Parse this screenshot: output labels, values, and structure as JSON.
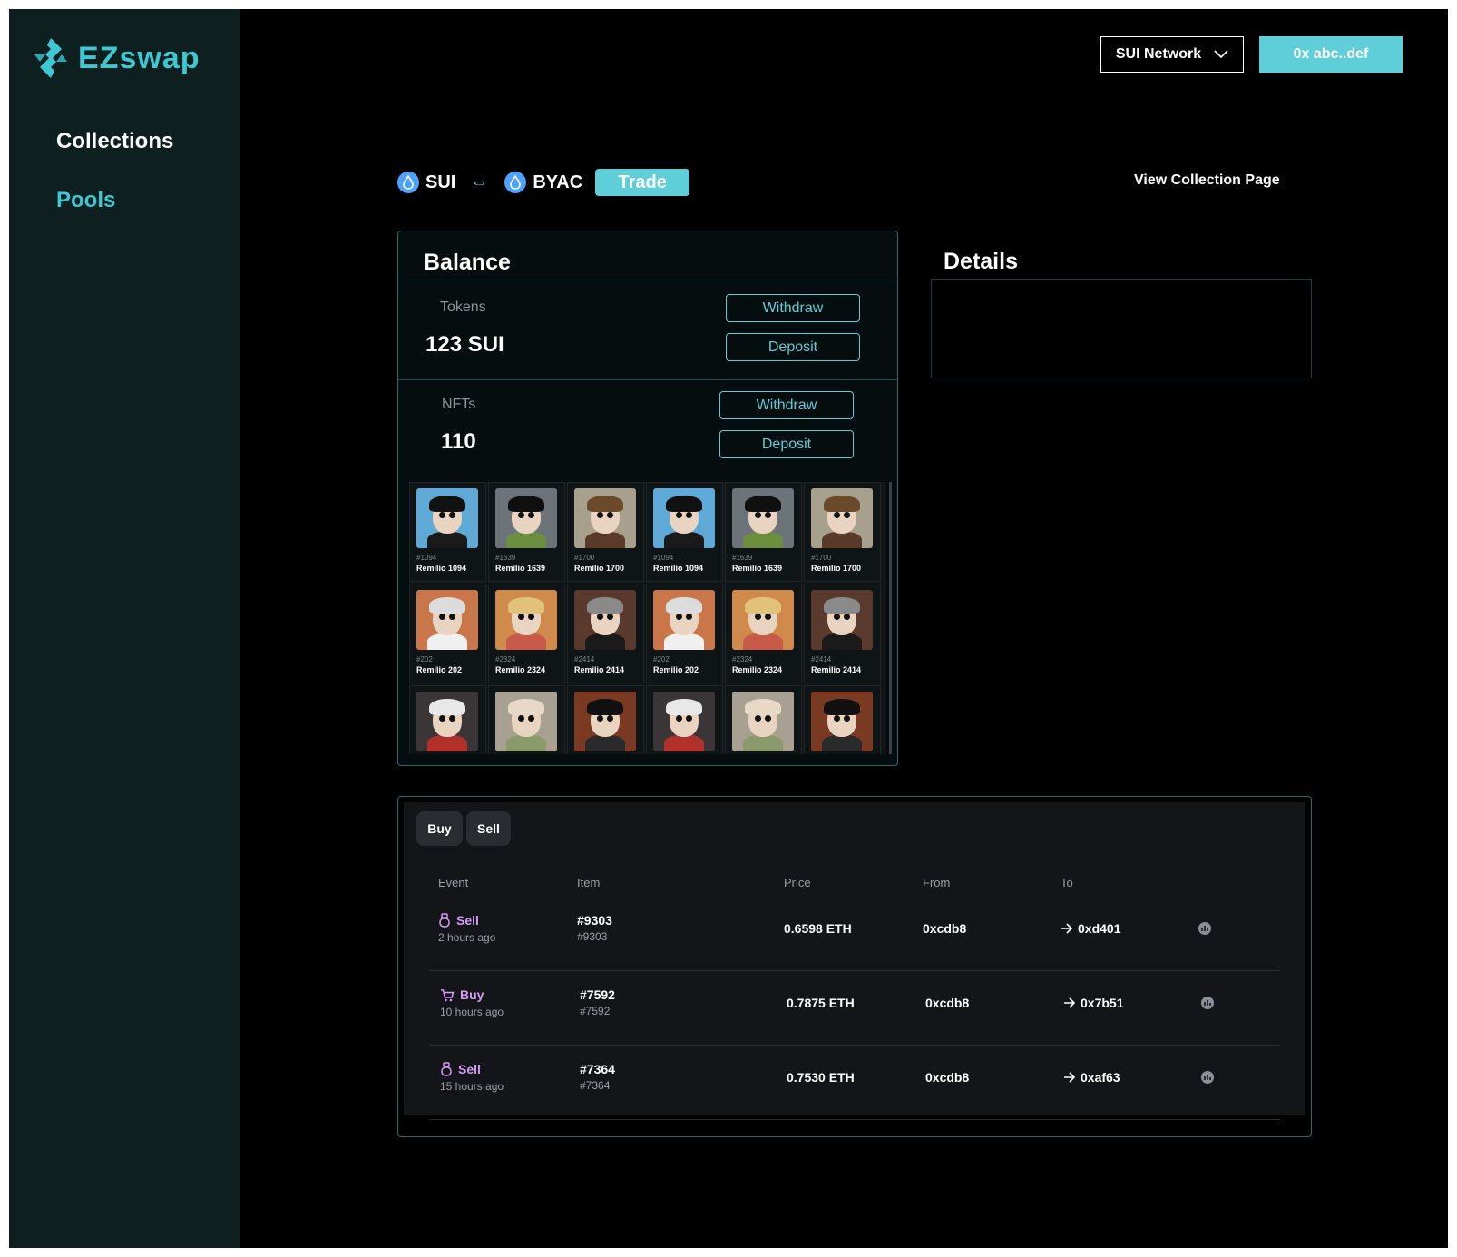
{
  "sidebar": {
    "brand": "EZswap",
    "items": [
      {
        "label": "Collections"
      },
      {
        "label": "Pools"
      }
    ]
  },
  "header": {
    "network": "SUI Network",
    "wallet": "0x abc..def"
  },
  "pair": {
    "token_a": "SUI",
    "token_b": "BYAC",
    "badge": "Trade",
    "view_link": "View Collection Page"
  },
  "balance": {
    "title": "Balance",
    "tokens": {
      "label": "Tokens",
      "value": "123 SUI",
      "withdraw": "Withdraw",
      "deposit": "Deposit"
    },
    "nfts": {
      "label": "NFTs",
      "value": "110",
      "withdraw": "Withdraw",
      "deposit": "Deposit"
    },
    "items": [
      {
        "id": "#1094",
        "name": "Remilio 1094",
        "bg": "#5fa9d6",
        "hair": "#111111",
        "body": "#1a1a1a"
      },
      {
        "id": "#1639",
        "name": "Remilio 1639",
        "bg": "#6d7479",
        "hair": "#101010",
        "body": "#6c8f3f"
      },
      {
        "id": "#1700",
        "name": "Remilio 1700",
        "bg": "#a7a08c",
        "hair": "#6b4a2b",
        "body": "#5a3b2a"
      },
      {
        "id": "#1094",
        "name": "Remilio 1094",
        "bg": "#5fa9d6",
        "hair": "#111111",
        "body": "#1a1a1a"
      },
      {
        "id": "#1639",
        "name": "Remilio 1639",
        "bg": "#6d7479",
        "hair": "#101010",
        "body": "#6c8f3f"
      },
      {
        "id": "#1700",
        "name": "Remilio 1700",
        "bg": "#a7a08c",
        "hair": "#6b4a2b",
        "body": "#5a3b2a"
      },
      {
        "id": "#202",
        "name": "Remilio 202",
        "bg": "#c8764a",
        "hair": "#dcdcdc",
        "body": "#f0f0f0"
      },
      {
        "id": "#2324",
        "name": "Remilio 2324",
        "bg": "#d08a4c",
        "hair": "#e0c27a",
        "body": "#c85a4a"
      },
      {
        "id": "#2414",
        "name": "Remilio 2414",
        "bg": "#5a3a2c",
        "hair": "#8a8a8a",
        "body": "#1a1a1a"
      },
      {
        "id": "#202",
        "name": "Remilio 202",
        "bg": "#c8764a",
        "hair": "#dcdcdc",
        "body": "#f0f0f0"
      },
      {
        "id": "#2324",
        "name": "Remilio 2324",
        "bg": "#d08a4c",
        "hair": "#e0c27a",
        "body": "#c85a4a"
      },
      {
        "id": "#2414",
        "name": "Remilio 2414",
        "bg": "#5a3a2c",
        "hair": "#8a8a8a",
        "body": "#1a1a1a"
      },
      {
        "id": "",
        "name": "",
        "bg": "#3a3536",
        "hair": "#e8e8e8",
        "body": "#b0302a"
      },
      {
        "id": "",
        "name": "",
        "bg": "#a8a090",
        "hair": "#e8d8c8",
        "body": "#8a9a6a"
      },
      {
        "id": "",
        "name": "",
        "bg": "#7a3a22",
        "hair": "#111111",
        "body": "#2a2a2a"
      },
      {
        "id": "",
        "name": "",
        "bg": "#3a3536",
        "hair": "#e8e8e8",
        "body": "#b0302a"
      },
      {
        "id": "",
        "name": "",
        "bg": "#a8a090",
        "hair": "#e8d8c8",
        "body": "#8a9a6a"
      },
      {
        "id": "",
        "name": "",
        "bg": "#7a3a22",
        "hair": "#111111",
        "body": "#2a2a2a"
      }
    ]
  },
  "details": {
    "title": "Details"
  },
  "activity": {
    "tabs": [
      {
        "label": "Buy"
      },
      {
        "label": "Sell"
      }
    ],
    "columns": {
      "event": "Event",
      "item": "Item",
      "price": "Price",
      "from": "From",
      "to": "To"
    },
    "rows": [
      {
        "type": "Sell",
        "time": "2 hours ago",
        "item": "#9303",
        "item_sub": "#9303",
        "price": "0.6598 ETH",
        "from": "0xcdb8",
        "to": "0xd401"
      },
      {
        "type": "Buy",
        "time": "10 hours ago",
        "item": "#7592",
        "item_sub": "#7592",
        "price": "0.7875 ETH",
        "from": "0xcdb8",
        "to": "0x7b51"
      },
      {
        "type": "Sell",
        "time": "15 hours ago",
        "item": "#7364",
        "item_sub": "#7364",
        "price": "0.7530 ETH",
        "from": "0xcdb8",
        "to": "0xaf63"
      }
    ]
  },
  "colors": {
    "accent": "#5ecfd8",
    "brand": "#3ec9d2",
    "sidebar": "#0d1f1f",
    "event": "#d59bf6"
  },
  "icons": {
    "logo": "ezswap-logo-icon",
    "network": "chevron-down-icon",
    "token": "sui-drop-icon",
    "swap": "swap-arrows-icon",
    "sell": "sell-bag-icon",
    "buy": "cart-icon",
    "to": "arrow-right-icon",
    "link": "explorer-link-icon"
  }
}
